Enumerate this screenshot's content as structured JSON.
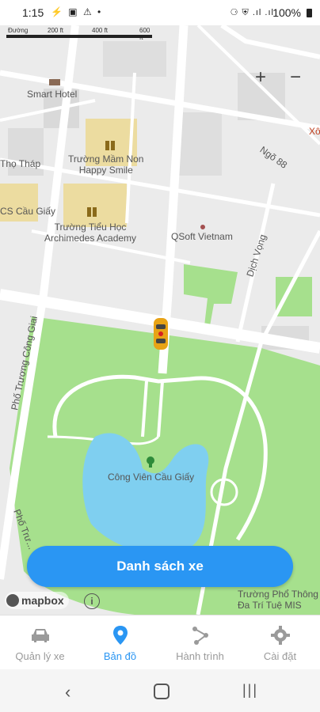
{
  "status_bar": {
    "time": "1:15",
    "left_icons": "⚡ ▣ ⚠ •",
    "right_icons": "⚆ ⛨ .ıl .ıl",
    "battery": "100%"
  },
  "map": {
    "scale_labels": [
      "Đường",
      "200 ft",
      "400 ft",
      "600 ft"
    ],
    "labels": {
      "smart_hotel": "Smart Hotel",
      "mam_non": "Trường Mầm Non\nHappy Smile",
      "tho_thap": "Thọ Tháp",
      "cs_cau_giay": "CS Cầu Giấy",
      "tieu_hoc": "Trường Tiểu Học\nArchimedes Academy",
      "qsoft": "QSoft Vietnam",
      "ngo_88": "Ngõ 88",
      "dich_vong": "Dịch Vọng",
      "truong_cong_giai": "Phố Trương Công Giai",
      "cong_vien": "Công Viên Cầu Giấy",
      "pho_truong": "Phố Trư...",
      "truong_pho_thong": "Trường Phổ Thông\nĐa Trí Tuệ MIS",
      "xo": "Xô"
    },
    "zoom_in": "+",
    "zoom_out": "−",
    "attribution": "mapbox",
    "info": "i"
  },
  "fab": {
    "label": "Danh sách xe"
  },
  "nav": [
    {
      "label": "Quản lý xe",
      "active": false
    },
    {
      "label": "Bản đồ",
      "active": true
    },
    {
      "label": "Hành trình",
      "active": false
    },
    {
      "label": "Cài đặt",
      "active": false
    }
  ],
  "system_nav": {
    "back": "‹",
    "recent": "|||"
  },
  "colors": {
    "accent": "#2a96f3",
    "park": "#a6e08d",
    "water": "#7fcff0",
    "road": "#ffffff",
    "block": "#dcdcdc",
    "school": "#ecdca0"
  }
}
